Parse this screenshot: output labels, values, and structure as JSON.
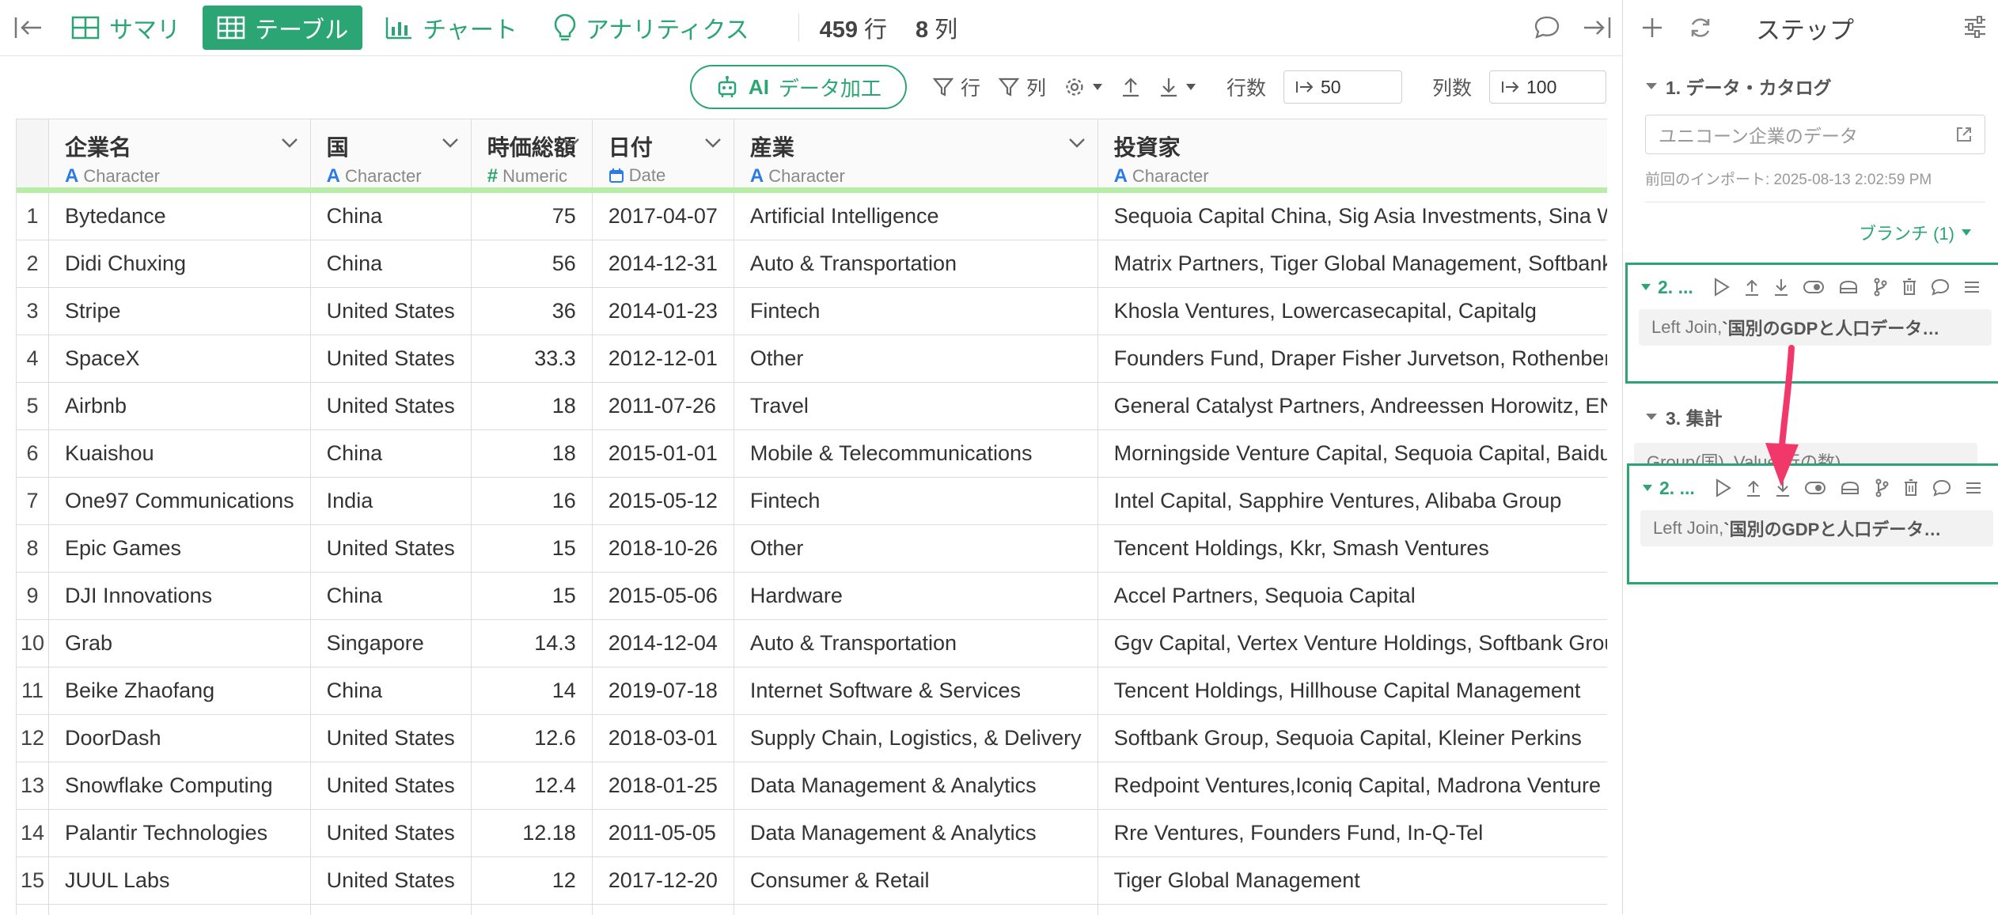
{
  "nav": {
    "tabs": [
      {
        "label": "サマリ",
        "icon": "summary-grid-icon"
      },
      {
        "label": "テーブル",
        "icon": "table-icon",
        "active": true
      },
      {
        "label": "チャート",
        "icon": "bar-chart-icon"
      },
      {
        "label": "アナリティクス",
        "icon": "lightbulb-icon"
      }
    ],
    "rows_count": "459",
    "rows_unit": "行",
    "cols_count": "8",
    "cols_unit": "列"
  },
  "toolbar": {
    "ai_prefix": "AI",
    "ai_label": "データ加工",
    "filter_rows": "行",
    "filter_cols": "列",
    "row_count_label": "行数",
    "row_count_value": "50",
    "col_count_label": "列数",
    "col_count_value": "100"
  },
  "table": {
    "columns": [
      {
        "name": "企業名",
        "type": "Character",
        "type_icon": "A"
      },
      {
        "name": "国",
        "type": "Character",
        "type_icon": "A"
      },
      {
        "name": "時価総額",
        "type": "Numeric",
        "type_icon": "#"
      },
      {
        "name": "日付",
        "type": "Date",
        "type_icon": "calendar"
      },
      {
        "name": "産業",
        "type": "Character",
        "type_icon": "A"
      },
      {
        "name": "投資家",
        "type": "Character",
        "type_icon": "A"
      }
    ],
    "rows": [
      [
        "1",
        "Bytedance",
        "China",
        "75",
        "2017-04-07",
        "Artificial Intelligence",
        "Sequoia Capital China, Sig Asia Investments, Sina Weibo, Softbank Group"
      ],
      [
        "2",
        "Didi Chuxing",
        "China",
        "56",
        "2014-12-31",
        "Auto & Transportation",
        "Matrix Partners, Tiger Global Management, Softbank Corp."
      ],
      [
        "3",
        "Stripe",
        "United States",
        "36",
        "2014-01-23",
        "Fintech",
        "Khosla Ventures, Lowercasecapital, Capitalg"
      ],
      [
        "4",
        "SpaceX",
        "United States",
        "33.3",
        "2012-12-01",
        "Other",
        "Founders Fund, Draper Fisher Jurvetson, Rothenberg Ventures"
      ],
      [
        "5",
        "Airbnb",
        "United States",
        "18",
        "2011-07-26",
        "Travel",
        "General Catalyst Partners, Andreessen Horowitz, ENIAC Ventures"
      ],
      [
        "6",
        "Kuaishou",
        "China",
        "18",
        "2015-01-01",
        "Mobile & Telecommunications",
        "Morningside Venture Capital, Sequoia Capital, Baidu"
      ],
      [
        "7",
        "One97 Communications",
        "India",
        "16",
        "2015-05-12",
        "Fintech",
        "Intel Capital, Sapphire Ventures, Alibaba Group"
      ],
      [
        "8",
        "Epic Games",
        "United States",
        "15",
        "2018-10-26",
        "Other",
        "Tencent Holdings, Kkr, Smash Ventures"
      ],
      [
        "9",
        "DJI Innovations",
        "China",
        "15",
        "2015-05-06",
        "Hardware",
        "Accel Partners, Sequoia Capital"
      ],
      [
        "10",
        "Grab",
        "Singapore",
        "14.3",
        "2014-12-04",
        "Auto & Transportation",
        "Ggv Capital, Vertex Venture Holdings, Softbank Group"
      ],
      [
        "11",
        "Beike Zhaofang",
        "China",
        "14",
        "2019-07-18",
        "Internet Software & Services",
        "Tencent Holdings, Hillhouse Capital Management"
      ],
      [
        "12",
        "DoorDash",
        "United States",
        "12.6",
        "2018-03-01",
        "Supply Chain, Logistics, & Delivery",
        "Softbank Group, Sequoia Capital, Kleiner Perkins"
      ],
      [
        "13",
        "Snowflake Computing",
        "United States",
        "12.4",
        "2018-01-25",
        "Data Management & Analytics",
        "Redpoint Ventures,Iconiq Capital, Madrona Venture Group"
      ],
      [
        "14",
        "Palantir Technologies",
        "United States",
        "12.18",
        "2011-05-05",
        "Data Management & Analytics",
        "Rre Ventures, Founders Fund, In-Q-Tel"
      ],
      [
        "15",
        "JUUL Labs",
        "United States",
        "12",
        "2017-12-20",
        "Consumer & Retail",
        "Tiger Global Management"
      ],
      [
        "16",
        "",
        "",
        "",
        "",
        "",
        ""
      ]
    ]
  },
  "steps_panel": {
    "title": "ステップ",
    "step1_label": "1. データ・カタログ",
    "dataset_name": "ユニコーン企業のデータ",
    "last_import": "前回のインポート: 2025-08-13 2:02:59 PM",
    "branch_label": "ブランチ (1)",
    "step2_num": "2. ...",
    "step2_prefix": "Left Join, ",
    "step2_text": "`国別のGDPと人口データ…",
    "step3_label": "3. 集計",
    "step3_text": "Group(国), Value(行の数)"
  },
  "colors": {
    "accent": "#2aa573",
    "header_underline": "#b9eca6",
    "arrow": "#f2386b"
  }
}
